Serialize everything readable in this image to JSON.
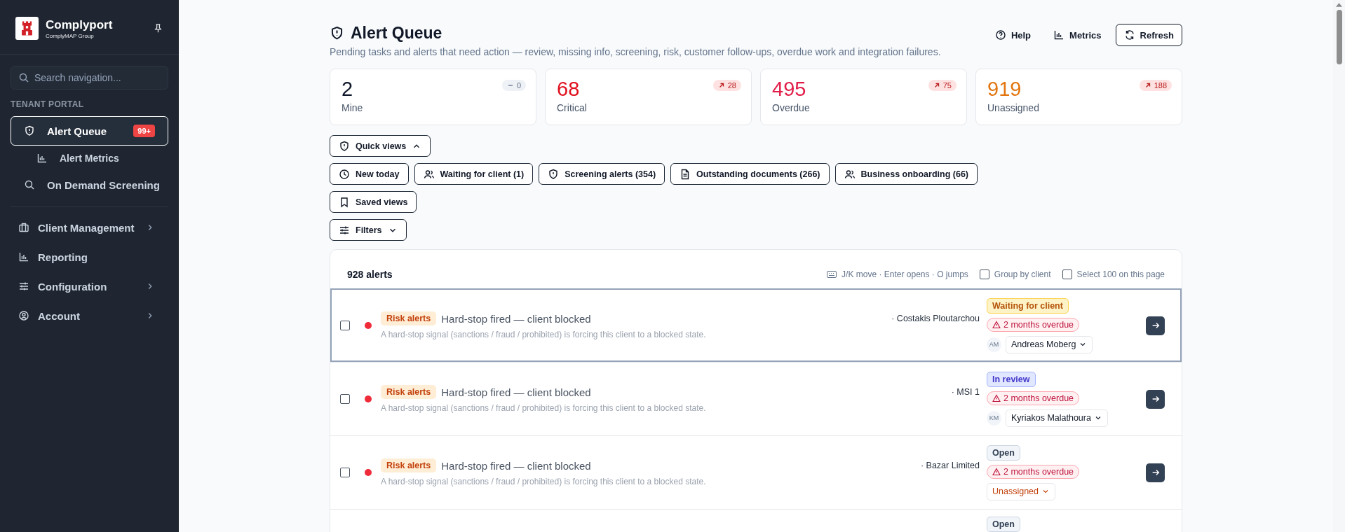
{
  "sidebar": {
    "brand": {
      "name": "Complyport",
      "subtitle": "ComplyMAP Group"
    },
    "search": {
      "placeholder": "Search navigation..."
    },
    "section_label": "TENANT PORTAL",
    "groups": [
      {
        "items": [
          {
            "label": "Alert Queue",
            "selected": true,
            "badge": "99+",
            "expandable": false,
            "children": [
              {
                "label": "Alert Metrics",
                "selected": false
              }
            ]
          },
          {
            "label": "On Demand Screening",
            "selected": false,
            "expandable": false
          }
        ]
      },
      {
        "items": [
          {
            "label": "Client Management",
            "selected": false,
            "expandable": true
          },
          {
            "label": "Reporting",
            "selected": false,
            "expandable": false
          },
          {
            "label": "Configuration",
            "selected": false,
            "expandable": true
          },
          {
            "label": "Account",
            "selected": false,
            "expandable": true
          }
        ]
      }
    ]
  },
  "page": {
    "title": "Alert Queue",
    "subtitle": "Pending tasks and alerts that need action — review, missing info, screening, risk, customer follow-ups, overdue work and integration failures.",
    "actions": [
      {
        "label": "Help",
        "kind": "ghost"
      },
      {
        "label": "Metrics",
        "kind": "ghost"
      },
      {
        "label": "Refresh",
        "kind": "outline"
      }
    ]
  },
  "stats": [
    {
      "value": "2",
      "label": "Mine",
      "color": "#0f172a",
      "kind": "flat",
      "delta": "0"
    },
    {
      "value": "68",
      "label": "Critical",
      "color": "#e0101e",
      "kind": "up",
      "delta": "28"
    },
    {
      "value": "495",
      "label": "Overdue",
      "color": "#e11d48",
      "kind": "up",
      "delta": "75"
    },
    {
      "value": "919",
      "label": "Unassigned",
      "color": "#e2750f",
      "kind": "up",
      "delta": "188"
    }
  ],
  "quick_views": {
    "label": "Quick views",
    "expanded": true,
    "chips": [
      "New today",
      "Waiting for client (1)",
      "Screening alerts (354)",
      "Outstanding documents (266)",
      "Business onboarding (66)"
    ]
  },
  "saved_views": {
    "label": "Saved views"
  },
  "filters": {
    "label": "Filters",
    "expanded": false
  },
  "alerts": {
    "count": "928 alerts",
    "shortcut_hint": "J/K move · Enter opens · O jumps",
    "options": [
      {
        "label": "Group by client",
        "checked": false
      },
      {
        "label": "Select 100 on this page",
        "checked": false
      }
    ],
    "rows": [
      {
        "selected": true,
        "checked": false,
        "color": "#ef2b3a",
        "tag": "Risk alerts",
        "title": "Hard-stop fired — client blocked",
        "description": "A hard-stop signal (sanctions / fraud / prohibited) is forcing this client to a blocked state.",
        "client": "· Costakis Ploutarchou",
        "status": {
          "label": "Waiting for client",
          "kind": "waiting"
        },
        "due": "2 months overdue",
        "assignee": {
          "kind": "user",
          "initials": "AM",
          "name": "Andreas Moberg"
        }
      },
      {
        "selected": false,
        "checked": false,
        "color": "#ef2b3a",
        "tag": "Risk alerts",
        "title": "Hard-stop fired — client blocked",
        "description": "A hard-stop signal (sanctions / fraud / prohibited) is forcing this client to a blocked state.",
        "client": "· MSI 1",
        "status": {
          "label": "In review",
          "kind": "review"
        },
        "due": "2 months overdue",
        "assignee": {
          "kind": "user",
          "initials": "KM",
          "name": "Kyriakos Malathoura"
        }
      },
      {
        "selected": false,
        "checked": false,
        "color": "#ef2b3a",
        "tag": "Risk alerts",
        "title": "Hard-stop fired — client blocked",
        "description": "A hard-stop signal (sanctions / fraud / prohibited) is forcing this client to a blocked state.",
        "client": "· Bazar Limited",
        "status": {
          "label": "Open",
          "kind": "open"
        },
        "due": "2 months overdue",
        "assignee": {
          "kind": "unassigned",
          "name": "Unassigned"
        }
      },
      {
        "selected": false,
        "status": {
          "label": "Open",
          "kind": "open"
        }
      }
    ]
  }
}
